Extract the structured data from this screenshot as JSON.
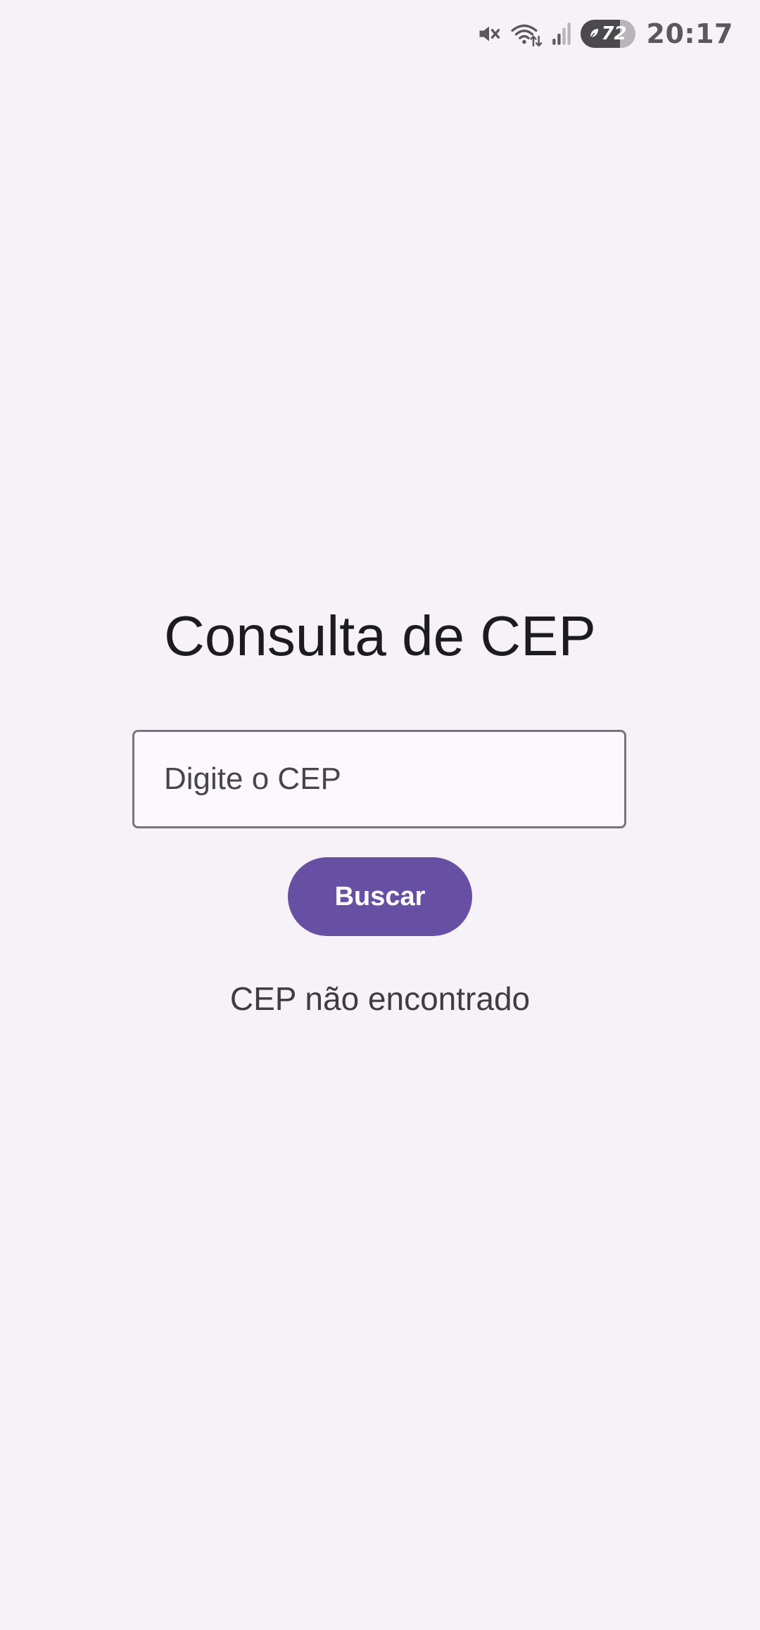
{
  "status_bar": {
    "icons": [
      "mute-icon",
      "wifi-icon",
      "signal-icon",
      "battery-saver-icon"
    ],
    "battery_level": "72",
    "time": "20:17",
    "colors": {
      "icon": "#5a585d",
      "battery_fill": "#4b494e",
      "battery_track": "#b7b4ba"
    }
  },
  "main": {
    "title": "Consulta de CEP",
    "cep_input": {
      "placeholder": "Digite o CEP",
      "value": ""
    },
    "search_button_label": "Buscar",
    "result_text": "CEP não encontrado"
  },
  "colors": {
    "background": "#f6f2f8",
    "accent": "#6750a4",
    "input_border": "#79747e",
    "input_background": "#fdf8fd"
  }
}
